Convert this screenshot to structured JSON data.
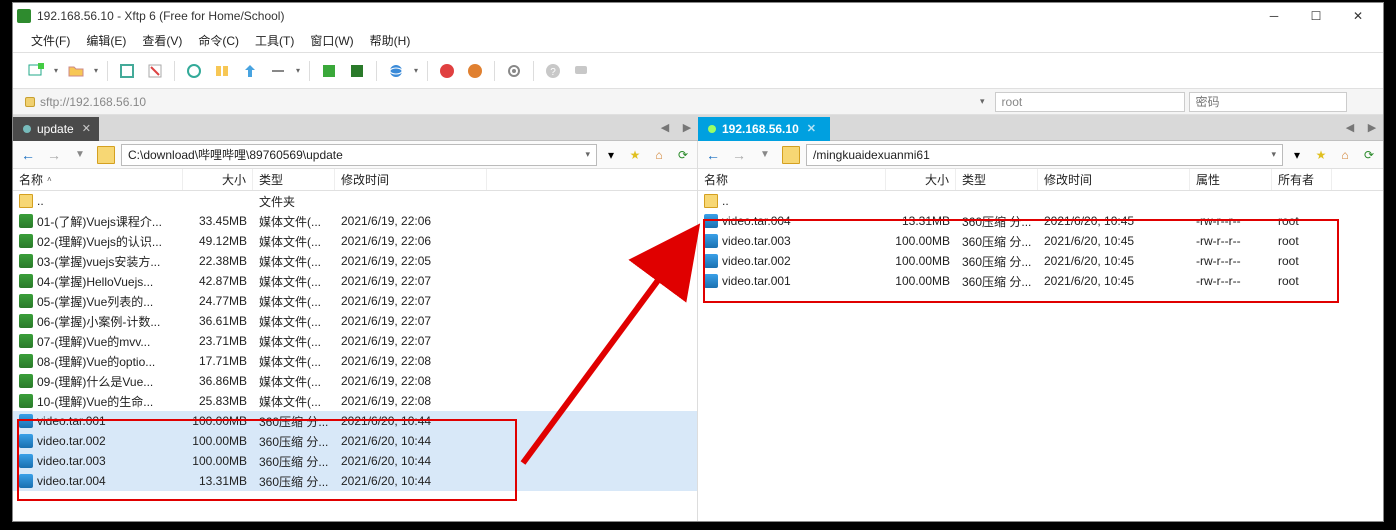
{
  "window": {
    "title": "192.168.56.10 - Xftp 6 (Free for Home/School)"
  },
  "menu": {
    "file": "文件(F)",
    "edit": "编辑(E)",
    "view": "查看(V)",
    "cmd": "命令(C)",
    "tool": "工具(T)",
    "win": "窗口(W)",
    "help": "帮助(H)"
  },
  "address": {
    "url": "sftp://192.168.56.10",
    "user": "root",
    "pass_placeholder": "密码"
  },
  "tabs": {
    "local": "update",
    "remote": "192.168.56.10"
  },
  "local": {
    "path": "C:\\download\\哔哩哔哩\\89760569\\update",
    "headers": {
      "name": "名称",
      "size": "大小",
      "type": "类型",
      "mtime": "修改时间"
    },
    "parent": {
      "name": "..",
      "type": "文件夹"
    },
    "rows": [
      {
        "icon": "mp4",
        "name": "01-(了解)Vuejs课程介...",
        "size": "33.45MB",
        "type": "媒体文件(...",
        "mtime": "2021/6/19, 22:06"
      },
      {
        "icon": "mp4",
        "name": "02-(理解)Vuejs的认识...",
        "size": "49.12MB",
        "type": "媒体文件(...",
        "mtime": "2021/6/19, 22:06"
      },
      {
        "icon": "mp4",
        "name": "03-(掌握)vuejs安装方...",
        "size": "22.38MB",
        "type": "媒体文件(...",
        "mtime": "2021/6/19, 22:05"
      },
      {
        "icon": "mp4",
        "name": "04-(掌握)HelloVuejs...",
        "size": "42.87MB",
        "type": "媒体文件(...",
        "mtime": "2021/6/19, 22:07"
      },
      {
        "icon": "mp4",
        "name": "05-(掌握)Vue列表的...",
        "size": "24.77MB",
        "type": "媒体文件(...",
        "mtime": "2021/6/19, 22:07"
      },
      {
        "icon": "mp4",
        "name": "06-(掌握)小案例-计数...",
        "size": "36.61MB",
        "type": "媒体文件(...",
        "mtime": "2021/6/19, 22:07"
      },
      {
        "icon": "mp4",
        "name": "07-(理解)Vue的mvv...",
        "size": "23.71MB",
        "type": "媒体文件(...",
        "mtime": "2021/6/19, 22:07"
      },
      {
        "icon": "mp4",
        "name": "08-(理解)Vue的optio...",
        "size": "17.71MB",
        "type": "媒体文件(...",
        "mtime": "2021/6/19, 22:08"
      },
      {
        "icon": "mp4",
        "name": "09-(理解)什么是Vue...",
        "size": "36.86MB",
        "type": "媒体文件(...",
        "mtime": "2021/6/19, 22:08"
      },
      {
        "icon": "mp4",
        "name": "10-(理解)Vue的生命...",
        "size": "25.83MB",
        "type": "媒体文件(...",
        "mtime": "2021/6/19, 22:08"
      },
      {
        "icon": "arc",
        "name": "video.tar.001",
        "size": "100.00MB",
        "type": "360压缩 分...",
        "mtime": "2021/6/20, 10:44",
        "sel": true
      },
      {
        "icon": "arc",
        "name": "video.tar.002",
        "size": "100.00MB",
        "type": "360压缩 分...",
        "mtime": "2021/6/20, 10:44",
        "sel": true
      },
      {
        "icon": "arc",
        "name": "video.tar.003",
        "size": "100.00MB",
        "type": "360压缩 分...",
        "mtime": "2021/6/20, 10:44",
        "sel": true
      },
      {
        "icon": "arc",
        "name": "video.tar.004",
        "size": "13.31MB",
        "type": "360压缩 分...",
        "mtime": "2021/6/20, 10:44",
        "sel": true
      }
    ]
  },
  "remote": {
    "path": "/mingkuaidexuanmi61",
    "headers": {
      "name": "名称",
      "size": "大小",
      "type": "类型",
      "mtime": "修改时间",
      "attr": "属性",
      "owner": "所有者"
    },
    "parent": {
      "name": ".."
    },
    "rows": [
      {
        "icon": "arc",
        "name": "video.tar.004",
        "size": "13.31MB",
        "type": "360压缩 分...",
        "mtime": "2021/6/20, 10:45",
        "attr": "-rw-r--r--",
        "owner": "root"
      },
      {
        "icon": "arc",
        "name": "video.tar.003",
        "size": "100.00MB",
        "type": "360压缩 分...",
        "mtime": "2021/6/20, 10:45",
        "attr": "-rw-r--r--",
        "owner": "root"
      },
      {
        "icon": "arc",
        "name": "video.tar.002",
        "size": "100.00MB",
        "type": "360压缩 分...",
        "mtime": "2021/6/20, 10:45",
        "attr": "-rw-r--r--",
        "owner": "root"
      },
      {
        "icon": "arc",
        "name": "video.tar.001",
        "size": "100.00MB",
        "type": "360压缩 分...",
        "mtime": "2021/6/20, 10:45",
        "attr": "-rw-r--r--",
        "owner": "root"
      }
    ]
  },
  "toolbar_icons": [
    "new-session-icon",
    "open-icon",
    "reconnect-icon",
    "disconnect-icon",
    "sync-icon",
    "home-icon",
    "up-icon",
    "view-icon",
    "xt1-icon",
    "xt2-icon",
    "globe-icon",
    "s-icon",
    "b-icon",
    "gear-icon",
    "help-icon",
    "bubble-icon"
  ]
}
